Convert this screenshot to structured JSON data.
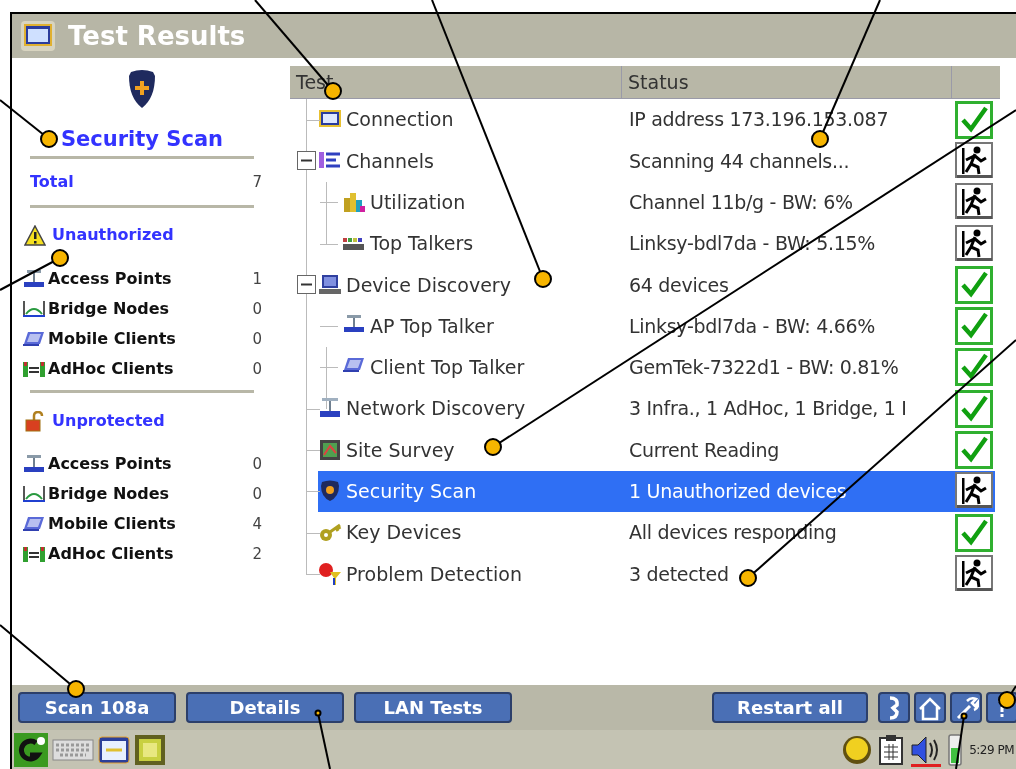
{
  "window": {
    "title": "Test Results"
  },
  "summary": {
    "title": "Security Scan",
    "total_label": "Total",
    "total_value": "7",
    "sections": [
      {
        "kind": "unauthorized",
        "title": "Unauthorized",
        "items": [
          {
            "kind": "access_point",
            "label": "Access Points",
            "count": "1"
          },
          {
            "kind": "bridge",
            "label": "Bridge Nodes",
            "count": "0"
          },
          {
            "kind": "mobile",
            "label": "Mobile Clients",
            "count": "0"
          },
          {
            "kind": "adhoc",
            "label": "AdHoc Clients",
            "count": "0"
          }
        ]
      },
      {
        "kind": "unprotected",
        "title": "Unprotected",
        "items": [
          {
            "kind": "access_point",
            "label": "Access Points",
            "count": "0"
          },
          {
            "kind": "bridge",
            "label": "Bridge Nodes",
            "count": "0"
          },
          {
            "kind": "mobile",
            "label": "Mobile Clients",
            "count": "4"
          },
          {
            "kind": "adhoc",
            "label": "AdHoc Clients",
            "count": "2"
          }
        ]
      }
    ]
  },
  "table": {
    "columns": [
      "Test",
      "Status"
    ],
    "rows": [
      {
        "kind": "passed",
        "test": "Connection",
        "status": "IP address 173.196.153.087",
        "selected": false
      },
      {
        "kind": "running",
        "test": "Channels",
        "status": "Scanning 44 channels...",
        "selected": false,
        "expanded": true,
        "children": [
          {
            "kind": "running",
            "test": "Utilization",
            "status": "Channel 11b/g - BW: 6%",
            "selected": false
          },
          {
            "kind": "running",
            "test": "Top Talkers",
            "status": "Linksy-bdl7da - BW: 5.15%",
            "selected": false
          }
        ]
      },
      {
        "kind": "passed",
        "test": "Device Discovery",
        "status": "64 devices",
        "selected": false,
        "expanded": true,
        "children": [
          {
            "kind": "passed",
            "test": "AP Top Talker",
            "status": "Linksy-bdl7da - BW: 4.66%",
            "selected": false
          },
          {
            "kind": "passed",
            "test": "Client Top Talker",
            "status": "GemTek-7322d1 - BW: 0.81%",
            "selected": false
          }
        ]
      },
      {
        "kind": "passed",
        "test": "Network Discovery",
        "status": "3 Infra., 1 AdHoc, 1 Bridge, 1 I",
        "selected": false
      },
      {
        "kind": "passed",
        "test": "Site Survey",
        "status": "Current Reading",
        "selected": false
      },
      {
        "kind": "running",
        "test": "Security Scan",
        "status": "1 Unauthorized devices",
        "selected": true
      },
      {
        "kind": "passed",
        "test": "Key Devices",
        "status": "All devices responding",
        "selected": false
      },
      {
        "kind": "running",
        "test": "Problem Detection",
        "status": "3 detected",
        "selected": false
      }
    ]
  },
  "buttons_left": [
    "Scan 108a",
    "Details",
    "LAN Tests"
  ],
  "buttons_right": [
    "Restart all"
  ],
  "taskbar": {
    "time": "5:29 PM"
  }
}
